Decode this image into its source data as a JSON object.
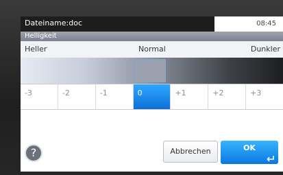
{
  "header": {
    "filename": "Dateiname:doc",
    "time": "08:45"
  },
  "section": {
    "title": "Helligkeit"
  },
  "scale_labels": {
    "left": "Heller",
    "middle": "Normal",
    "right": "Dunkler"
  },
  "scale": {
    "values": [
      "-3",
      "-2",
      "-1",
      "0",
      "+1",
      "+2",
      "+3"
    ],
    "selected": "0"
  },
  "footer": {
    "help_icon": "?",
    "cancel_label": "Abbrechen",
    "ok_label": "OK"
  },
  "colors": {
    "accent": "#1a8ff0",
    "header_bg": "#1d1d1d"
  }
}
